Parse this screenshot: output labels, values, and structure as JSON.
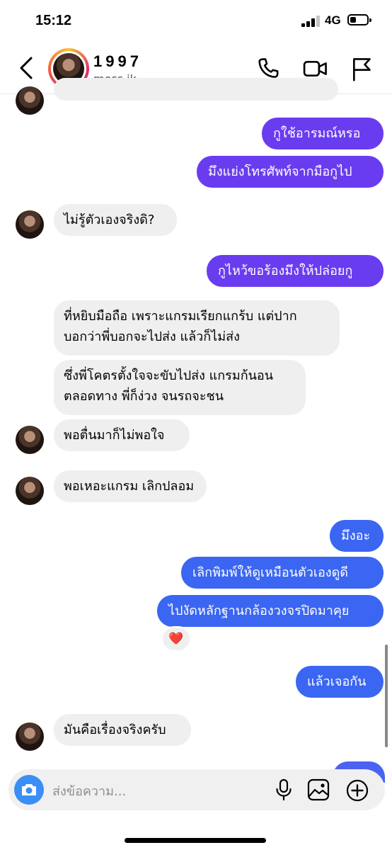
{
  "status": {
    "time": "15:12",
    "network": "4G",
    "signal_bars": 3,
    "battery_level": 0.2
  },
  "header": {
    "name": "1997",
    "username": "moss.jk",
    "icons": [
      "back-icon",
      "phone-icon",
      "video-icon",
      "flag-icon"
    ]
  },
  "colors": {
    "outgoing_purple": "#6a3cf0",
    "outgoing_blue": "#3b66f2",
    "incoming": "#efefef",
    "camera": "#3a8ef6"
  },
  "messages": [
    {
      "side": "out",
      "text": "กูใช้อารมณ์หรอ"
    },
    {
      "side": "out",
      "text": "มึงแย่งโทรศัพท์จากมือกูไป"
    },
    {
      "side": "in",
      "text": "ไม่รู้ตัวเองจริงดิ?"
    },
    {
      "side": "out",
      "text": "กูไหว้ขอร้องมึงให้ปล่อยกู"
    },
    {
      "side": "in",
      "lines": [
        "ที่หยิบมือถือ เพราะแกรมเรียกแกร้บ แต่ปาก",
        "บอกว่าพี่บอกจะไปส่ง แล้วก็ไม่ส่ง"
      ]
    },
    {
      "side": "in",
      "lines": [
        "ซึ่งพี่โคตรตั้งใจจะขับไปส่ง แกรมก้นอน",
        "ตลอดทาง พี่ก็ง่วง จนรถจะชน"
      ]
    },
    {
      "side": "in",
      "text": "พอตื่นมาก็ไม่พอใจ"
    },
    {
      "side": "in",
      "text": "พอเหอะแกรม เลิกปลอม"
    },
    {
      "side": "out",
      "text": "มึงอะ"
    },
    {
      "side": "out",
      "text": "เลิกพิมพ์ให้ดูเหมือนตัวเองดูดี"
    },
    {
      "side": "out",
      "text": "ไปงัดหลักฐานกล้องวงจรปิดมาคุย",
      "reaction": "❤️"
    },
    {
      "side": "out",
      "text": "แล้วเจอกัน"
    },
    {
      "side": "in",
      "text": "มันคือเรื่องจริงครับ"
    }
  ],
  "composer": {
    "placeholder": "ส่งข้อความ...",
    "icons": [
      "camera-icon",
      "mic-icon",
      "gallery-icon",
      "plus-circle-icon"
    ]
  }
}
